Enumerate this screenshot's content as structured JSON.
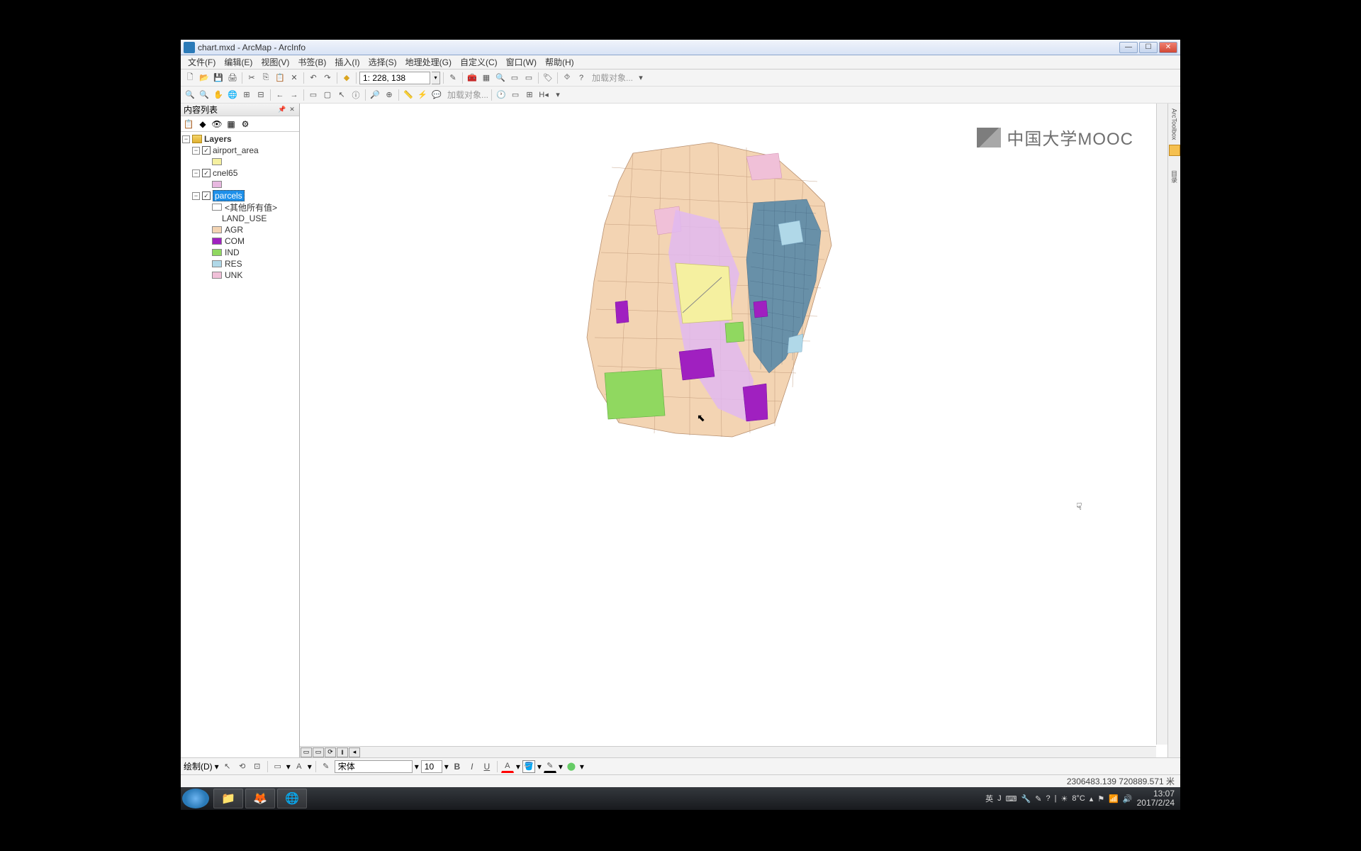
{
  "titlebar": {
    "title": "chart.mxd - ArcMap - ArcInfo"
  },
  "menu": [
    "文件(F)",
    "编辑(E)",
    "视图(V)",
    "书签(B)",
    "插入(I)",
    "选择(S)",
    "地理处理(G)",
    "自定义(C)",
    "窗口(W)",
    "帮助(H)"
  ],
  "toolbar1": {
    "scale": "1: 228, 138",
    "add_data_hint": "加载对象..."
  },
  "toc": {
    "title": "内容列表",
    "root": "Layers",
    "layers": [
      {
        "name": "airport_area",
        "checked": true,
        "swatch": "#F5F0A0"
      },
      {
        "name": "cnel65",
        "checked": true,
        "swatch": "#E8B8E0"
      },
      {
        "name": "parcels",
        "checked": true,
        "selected": true,
        "heading1": "<其他所有值>",
        "field": "LAND_USE",
        "classes": [
          {
            "label": "AGR",
            "color": "#F3D4B3"
          },
          {
            "label": "COM",
            "color": "#A020C0"
          },
          {
            "label": "IND",
            "color": "#90D860"
          },
          {
            "label": "RES",
            "color": "#B0D8E8"
          },
          {
            "label": "UNK",
            "color": "#F0C0D8"
          }
        ]
      }
    ]
  },
  "draw": {
    "label": "绘制(D)",
    "font": "宋体",
    "size": "10"
  },
  "status": {
    "coords": "2306483.139  720889.571 米"
  },
  "rail": {
    "toolbox": "ArcToolbox",
    "catalog": "目录"
  },
  "watermark": "中国大学MOOC",
  "taskbar": {
    "lang": "英",
    "ime": "J",
    "temp": "8°C",
    "time": "13:07",
    "date": "2017/2/24"
  }
}
